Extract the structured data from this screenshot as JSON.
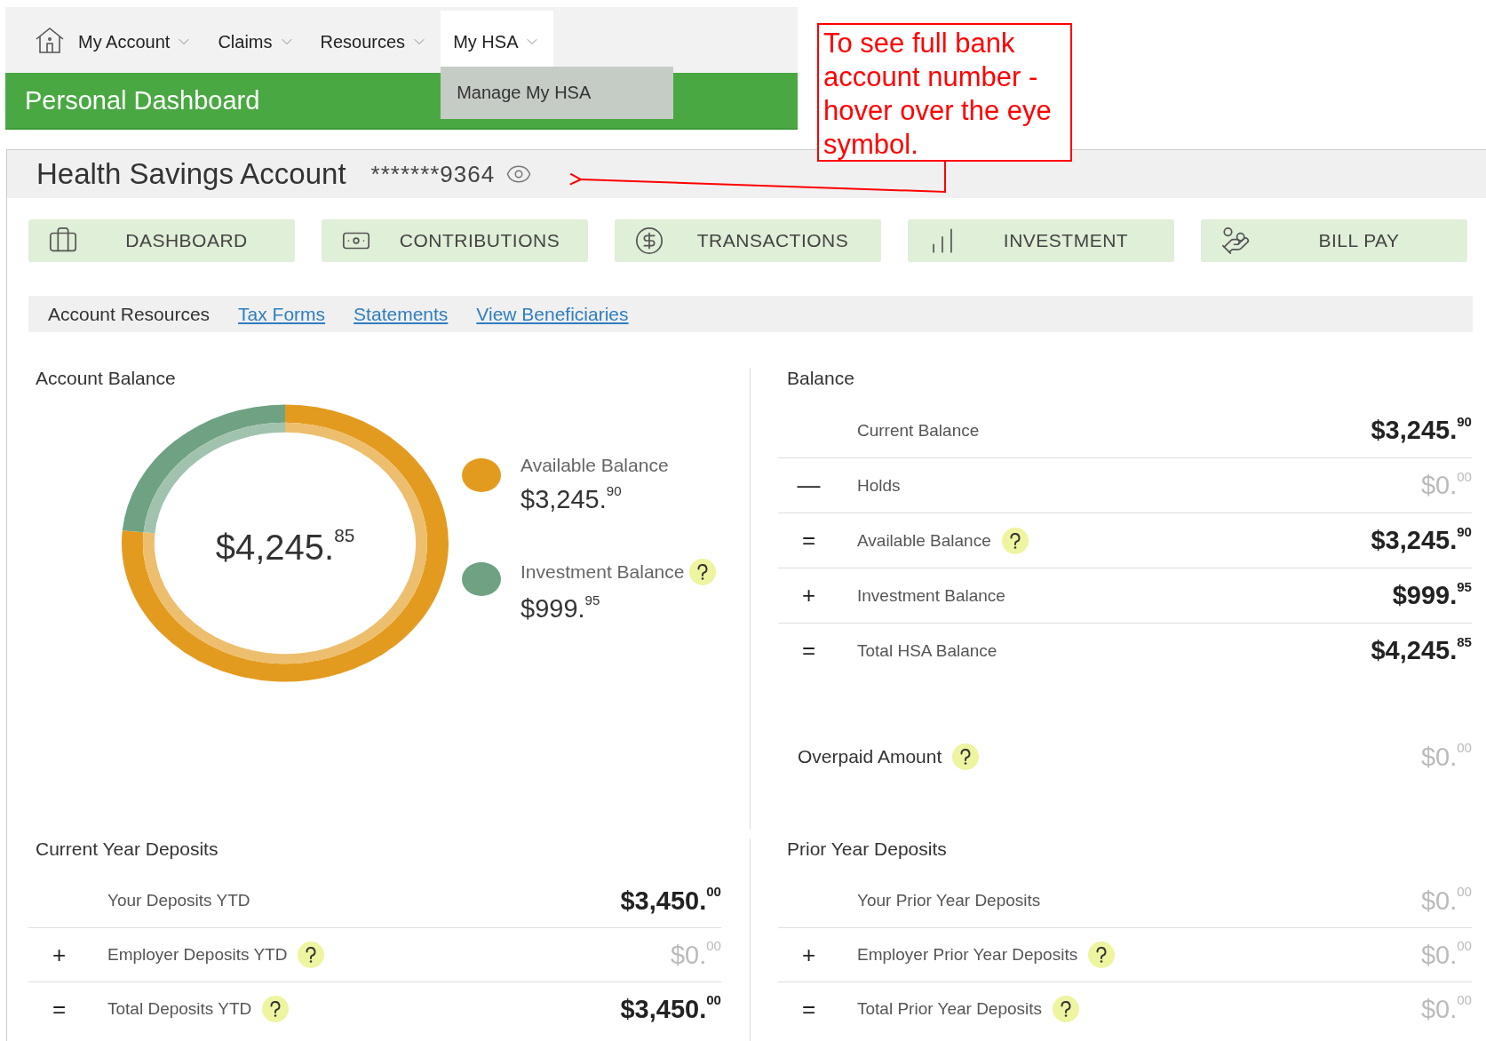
{
  "nav": {
    "items": [
      {
        "label": "My Account",
        "selected": false
      },
      {
        "label": "Claims",
        "selected": false
      },
      {
        "label": "Resources",
        "selected": false
      },
      {
        "label": "My HSA",
        "selected": true,
        "menu": [
          "Manage My HSA"
        ]
      }
    ]
  },
  "banner": {
    "title": "Personal Dashboard"
  },
  "annotation": {
    "text": "To see full bank account number - hover over the eye symbol."
  },
  "account": {
    "title": "Health Savings Account",
    "number": "*******9364"
  },
  "tabs": [
    {
      "label": "DASHBOARD"
    },
    {
      "label": "CONTRIBUTIONS"
    },
    {
      "label": "TRANSACTIONS"
    },
    {
      "label": "INVESTMENT"
    },
    {
      "label": "BILL PAY"
    }
  ],
  "resources": {
    "label": "Account Resources",
    "links": [
      "Tax Forms",
      "Statements",
      "View Beneficiaries"
    ]
  },
  "account_balance": {
    "title": "Account Balance",
    "center_total": "$4,245.$^{85}$",
    "chart_data": {
      "type": "donut",
      "categories": [
        "Available Balance",
        "Investment Balance"
      ],
      "series": [
        {
          "values": [
            76.45,
            23.55
          ]
        }
      ],
      "legend": "right"
    },
    "legend": [
      {
        "amount": "$3,245.$^{90}$",
        "color": "#e39b1f",
        "help": false
      },
      {
        "amount": "$999.$^{95}$",
        "color": "#6fa283",
        "help": true
      }
    ]
  },
  "balance": {
    "title": "Balance",
    "rows": [
      {
        "label": "Current Balance",
        "help": false,
        "amount": "$3,245.$^{90}$",
        "dimmed": false
      },
      {
        "sign": "—",
        "label": "Holds",
        "help": false,
        "amount": "$0.$^{00}$",
        "dimmed": true
      },
      {
        "sign": "=",
        "label": "Available Balance",
        "help": true,
        "amount": "$3,245.$^{90}$",
        "dimmed": false
      },
      {
        "sign": "+",
        "label": "Investment Balance",
        "help": false,
        "amount": "$999.$^{95}$",
        "dimmed": false
      },
      {
        "sign": "=",
        "label": "Total HSA Balance",
        "help": false,
        "amount": "$4,245.$^{85}$",
        "dimmed": false
      }
    ],
    "overpaid": {
      "label": "Overpaid Amount",
      "help": true,
      "amount": "$0.$^{00}$",
      "dimmed": true
    }
  },
  "current_year_deposits": {
    "title": "Current Year Deposits",
    "rows": [
      {
        "label": "Your Deposits YTD",
        "help": false,
        "amount": "$3,450.$^{00}$",
        "dimmed": false
      },
      {
        "sign": "+",
        "label": "Employer Deposits YTD",
        "help": true,
        "amount": "$0.$^{00}$",
        "dimmed": true
      },
      {
        "sign": "=",
        "label": "Total Deposits YTD",
        "help": true,
        "amount": "$3,450.$^{00}$",
        "dimmed": false
      }
    ]
  },
  "prior_year_deposits": {
    "title": "Prior Year Deposits",
    "rows": [
      {
        "label": "Your Prior Year Deposits",
        "help": false,
        "amount": "$0.$^{00}$",
        "dimmed": true
      },
      {
        "sign": "+",
        "label": "Employer Prior Year Deposits",
        "help": true,
        "amount": "$0.$^{00}$",
        "dimmed": true
      },
      {
        "sign": "=",
        "label": "Total Prior Year Deposits",
        "help": true,
        "amount": "$0.$^{00}$",
        "dimmed": true
      }
    ]
  }
}
